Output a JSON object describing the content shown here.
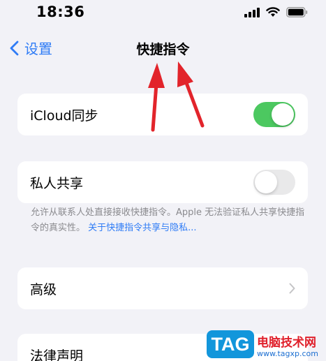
{
  "status_bar": {
    "time": "18:36",
    "icons": [
      "signal-icon",
      "wifi-icon",
      "battery-icon"
    ]
  },
  "nav": {
    "back_label": "设置",
    "title": "快捷指令"
  },
  "settings": {
    "icloud_sync": {
      "label": "iCloud同步",
      "enabled": true
    },
    "private_sharing": {
      "label": "私人共享",
      "enabled": false
    },
    "footnote_text": "允许从联系人处直接接收快捷指令。Apple 无法验证私人共享快捷指令的真实性。",
    "footnote_link": "关于快捷指令共享与隐私...",
    "advanced": {
      "label": "高级"
    },
    "legal": {
      "label": "法律声明"
    }
  },
  "watermark": {
    "logo_text": "TAG",
    "site_name": "电脑技术网",
    "url": "www.tagxp.com"
  },
  "colors": {
    "accent": "#2f7cf6",
    "toggle_on": "#4cc860",
    "annotation_arrow": "#e2242b"
  }
}
